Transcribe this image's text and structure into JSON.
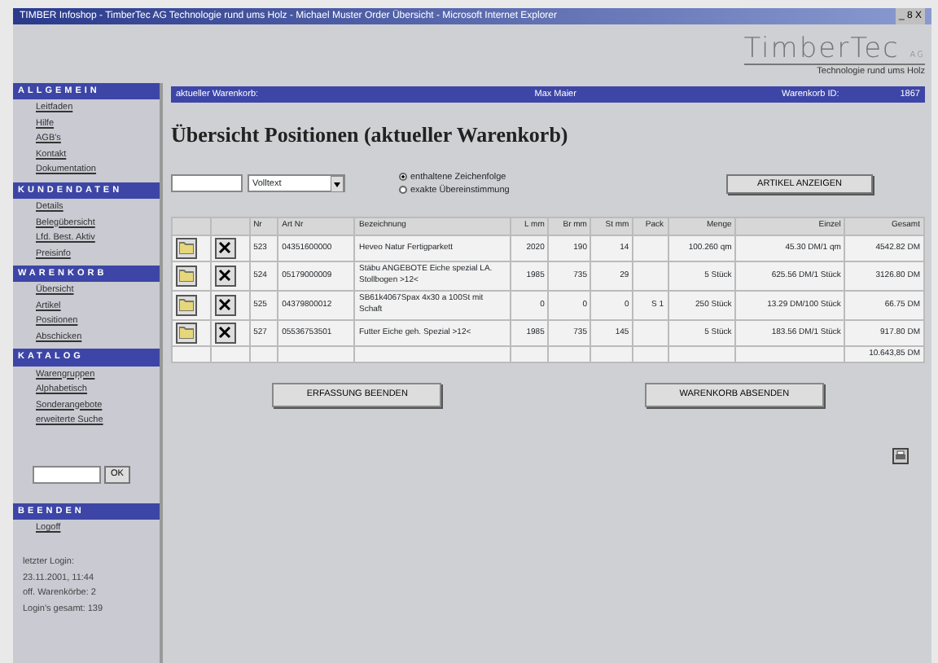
{
  "window": {
    "title": "TIMBER Infoshop - TimberTec AG Technologie rund ums Holz - Michael Muster Order Übersicht - Microsoft Internet Explorer",
    "controls": "_ 8 X"
  },
  "header": {
    "logo": "TimberTec",
    "logo_suffix": "AG",
    "tagline": "Technologie rund ums Holz"
  },
  "sidebar": {
    "sections": [
      {
        "title": "ALLGEMEIN",
        "items": [
          "Leitfaden",
          "Hilfe",
          "AGB's",
          "Kontakt",
          "Dokumentation"
        ]
      },
      {
        "title": "KUNDENDATEN",
        "items": [
          "Details",
          "Belegübersicht",
          "Lfd. Best. Aktiv",
          "Preisinfo"
        ]
      },
      {
        "title": "WARENKORB",
        "items": [
          "Übersicht",
          "Artikel",
          "Positionen",
          "Abschicken"
        ]
      },
      {
        "title": "KATALOG",
        "items": [
          "Warengruppen",
          "Alphabetisch",
          "Sonderangebote",
          "erweiterte Suche"
        ]
      }
    ],
    "search_button": "OK",
    "end_section": {
      "title": "BEENDEN",
      "items": [
        "Logoff"
      ]
    },
    "footer": [
      "letzter Login:",
      "23.11.2001, 11:44",
      "off. Warenkörbe: 2",
      "Login's gesamt: 139"
    ]
  },
  "cart_bar": [
    "aktueller Warenkorb:",
    "Max Maier",
    "Warenkorb ID:",
    "1867"
  ],
  "heading": "Übersicht Positionen (aktueller Warenkorb)",
  "filter": {
    "select_value": "Volltext",
    "radios": [
      {
        "label": "enthaltene Zeichenfolge",
        "selected": true
      },
      {
        "label": "exakte Übereinstimmung",
        "selected": false
      }
    ],
    "button": "ARTIKEL ANZEIGEN"
  },
  "table": {
    "columns": [
      "Nr",
      "Art Nr",
      "Bezeichnung",
      "L mm",
      "Br mm",
      "St mm",
      "Pack",
      "Menge",
      "Einzel",
      "Gesamt"
    ],
    "rows": [
      {
        "cells": [
          "523",
          "04351600000",
          "Heveo Natur Fertigparkett",
          "2020",
          "190",
          "14",
          "",
          "100.260 qm",
          "45.30 DM/1 qm",
          "4542.82 DM"
        ]
      },
      {
        "cells": [
          "524",
          "05179000009",
          "Stäbu ANGEBOTE Eiche spezial LA. Stollbogen >12<",
          "1985",
          "735",
          "29",
          "",
          "5 Stück",
          "625.56 DM/1 Stück",
          "3126.80 DM"
        ]
      },
      {
        "cells": [
          "525",
          "04379800012",
          "SB61k4067Spax 4x30 a 100St mit Schaft",
          "0",
          "0",
          "0",
          "S 1",
          "250 Stück",
          "13.29 DM/100 Stück",
          "66.75 DM"
        ]
      },
      {
        "cells": [
          "527",
          "05536753501",
          "Futter Eiche geh. Spezial >12<",
          "1985",
          "735",
          "145",
          "",
          "5 Stück",
          "183.56 DM/1 Stück",
          "917.80 DM"
        ]
      }
    ],
    "total": "10.643,85 DM"
  },
  "buttons": [
    "ERFASSUNG BEENDEN",
    "WARENKORB ABSENDEN"
  ]
}
